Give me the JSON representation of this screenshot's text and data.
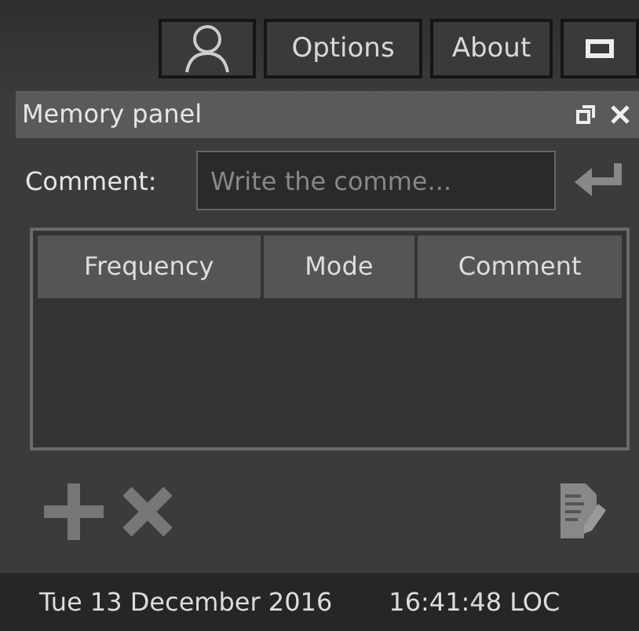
{
  "toolbar": {
    "buttons": [
      {
        "kind": "user"
      },
      {
        "kind": "text",
        "label": "Options"
      },
      {
        "kind": "text",
        "label": "About"
      },
      {
        "kind": "window"
      }
    ]
  },
  "panel": {
    "title": "Memory panel",
    "comment_label": "Comment:",
    "comment_placeholder": "Write the comme...",
    "table": {
      "columns": [
        "Frequency",
        "Mode",
        "Comment"
      ]
    }
  },
  "status_bar": {
    "date": "Tue 13 December 2016",
    "time": "16:41:48 LOC"
  }
}
